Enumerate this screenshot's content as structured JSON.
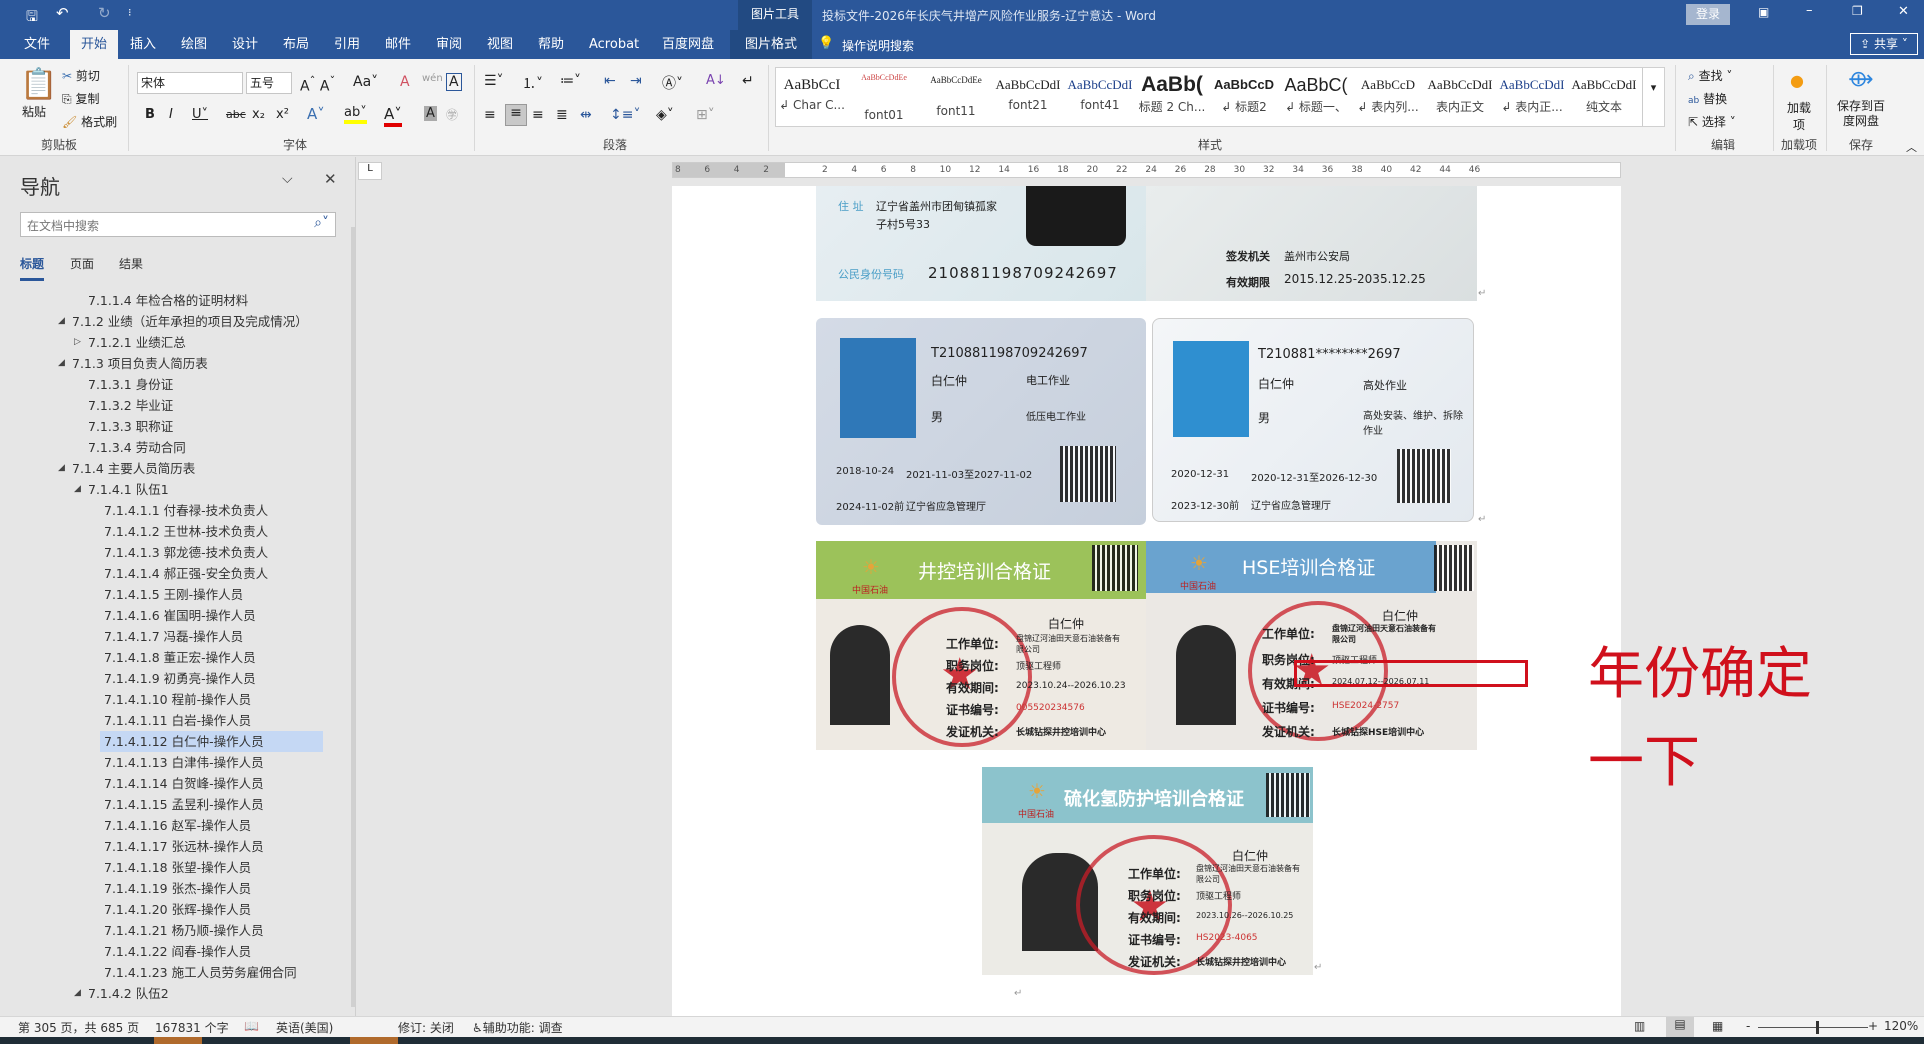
{
  "titlebar": {
    "context_tool": "图片工具",
    "title": "投标文件-2026年长庆气井增产风险作业服务-辽宁意达  -  Word",
    "login": "登录",
    "icons": [
      "save-icon",
      "undo-icon",
      "redo-icon",
      "customize-icon",
      "ribbon-display-icon",
      "minimize-icon",
      "restore-icon",
      "close-icon"
    ]
  },
  "tabs": [
    {
      "label": "文件"
    },
    {
      "label": "开始",
      "active": true
    },
    {
      "label": "插入"
    },
    {
      "label": "绘图"
    },
    {
      "label": "设计"
    },
    {
      "label": "布局"
    },
    {
      "label": "引用"
    },
    {
      "label": "邮件"
    },
    {
      "label": "审阅"
    },
    {
      "label": "视图"
    },
    {
      "label": "帮助"
    },
    {
      "label": "Acrobat"
    },
    {
      "label": "百度网盘"
    },
    {
      "label": "图片格式"
    }
  ],
  "tell_me": "操作说明搜索",
  "share": "共享",
  "ribbon": {
    "clipboard": {
      "paste": "粘贴",
      "cut": "剪切",
      "copy": "复制",
      "format_painter": "格式刷",
      "label": "剪贴板"
    },
    "font": {
      "name": "宋体",
      "size": "五号",
      "label": "字体",
      "highlight_color": "#ffff00",
      "font_color": "#e00000"
    },
    "paragraph": {
      "label": "段落"
    },
    "styles": {
      "label": "样式",
      "items": [
        {
          "preview": "AaBbCcI",
          "name": "↲ Char C..."
        },
        {
          "preview": "AaBbCcDdEe",
          "name": "font01"
        },
        {
          "preview": "AaBbCcDdEe",
          "name": "font11"
        },
        {
          "preview": "AaBbCcDdI",
          "name": "font21"
        },
        {
          "preview": "AaBbCcDdI",
          "name": "font41"
        },
        {
          "preview": "AaBb(",
          "name": "标题 2 Ch..."
        },
        {
          "preview": "AaBbCcD",
          "name": "↲ 标题2"
        },
        {
          "preview": "AaBbC(",
          "name": "↲ 标题一、"
        },
        {
          "preview": "AaBbCcD",
          "name": "↲ 表内列..."
        },
        {
          "preview": "AaBbCcDdI",
          "name": "表内正文"
        },
        {
          "preview": "AaBbCcDdI",
          "name": "↲ 表内正..."
        },
        {
          "preview": "AaBbCcDdI",
          "name": "纯文本"
        }
      ]
    },
    "editing": {
      "find": "查找",
      "replace": "替换",
      "select": "选择",
      "label": "编辑"
    },
    "addins": {
      "button": "加载项",
      "label": "加载项"
    },
    "save": {
      "button": "保存到百度网盘",
      "label": "保存"
    }
  },
  "nav": {
    "title": "导航",
    "search_placeholder": "在文档中搜索",
    "tabs": [
      "标题",
      "页面",
      "结果"
    ],
    "active_tab": "标题",
    "items": [
      {
        "text": "7.1.1.4 年检合格的证明材料",
        "level": 3,
        "toggle": "none"
      },
      {
        "text": "7.1.2 业绩（近年承担的项目及完成情况）",
        "level": 2,
        "toggle": "expanded"
      },
      {
        "text": "7.1.2.1 业绩汇总",
        "level": 3,
        "toggle": "collapsed"
      },
      {
        "text": "7.1.3 项目负责人简历表",
        "level": 2,
        "toggle": "expanded"
      },
      {
        "text": "7.1.3.1 身份证",
        "level": 3,
        "toggle": "none"
      },
      {
        "text": "7.1.3.2 毕业证",
        "level": 3,
        "toggle": "none"
      },
      {
        "text": "7.1.3.3 职称证",
        "level": 3,
        "toggle": "none"
      },
      {
        "text": "7.1.3.4 劳动合同",
        "level": 3,
        "toggle": "none"
      },
      {
        "text": "7.1.4 主要人员简历表",
        "level": 2,
        "toggle": "expanded"
      },
      {
        "text": "7.1.4.1 队伍1",
        "level": 3,
        "toggle": "expanded"
      },
      {
        "text": "7.1.4.1.1 付春禄-技术负责人",
        "level": 4,
        "toggle": "none"
      },
      {
        "text": "7.1.4.1.2 王世林-技术负责人",
        "level": 4,
        "toggle": "none"
      },
      {
        "text": "7.1.4.1.3 郭龙德-技术负责人",
        "level": 4,
        "toggle": "none"
      },
      {
        "text": "7.1.4.1.4 郝正强-安全负责人",
        "level": 4,
        "toggle": "none"
      },
      {
        "text": "7.1.4.1.5 王刚-操作人员",
        "level": 4,
        "toggle": "none"
      },
      {
        "text": "7.1.4.1.6 崔国明-操作人员",
        "level": 4,
        "toggle": "none"
      },
      {
        "text": "7.1.4.1.7 冯磊-操作人员",
        "level": 4,
        "toggle": "none"
      },
      {
        "text": "7.1.4.1.8 董正宏-操作人员",
        "level": 4,
        "toggle": "none"
      },
      {
        "text": "7.1.4.1.9 初勇亮-操作人员",
        "level": 4,
        "toggle": "none"
      },
      {
        "text": "7.1.4.1.10 程前-操作人员",
        "level": 4,
        "toggle": "none"
      },
      {
        "text": "7.1.4.1.11 白岩-操作人员",
        "level": 4,
        "toggle": "none"
      },
      {
        "text": "7.1.4.1.12 白仁仲-操作人员",
        "level": 4,
        "toggle": "none",
        "selected": true
      },
      {
        "text": "7.1.4.1.13 白津伟-操作人员",
        "level": 4,
        "toggle": "none"
      },
      {
        "text": "7.1.4.1.14 白贺峰-操作人员",
        "level": 4,
        "toggle": "none"
      },
      {
        "text": "7.1.4.1.15 孟昱利-操作人员",
        "level": 4,
        "toggle": "none"
      },
      {
        "text": "7.1.4.1.16 赵军-操作人员",
        "level": 4,
        "toggle": "none"
      },
      {
        "text": "7.1.4.1.17 张远林-操作人员",
        "level": 4,
        "toggle": "none"
      },
      {
        "text": "7.1.4.1.18 张望-操作人员",
        "level": 4,
        "toggle": "none"
      },
      {
        "text": "7.1.4.1.19 张杰-操作人员",
        "level": 4,
        "toggle": "none"
      },
      {
        "text": "7.1.4.1.20 张辉-操作人员",
        "level": 4,
        "toggle": "none"
      },
      {
        "text": "7.1.4.1.21 杨乃顺-操作人员",
        "level": 4,
        "toggle": "none"
      },
      {
        "text": "7.1.4.1.22 阎春-操作人员",
        "level": 4,
        "toggle": "none"
      },
      {
        "text": "7.1.4.1.23 施工人员劳务雇佣合同",
        "level": 4,
        "toggle": "none"
      },
      {
        "text": "7.1.4.2 队伍2",
        "level": 3,
        "toggle": "expanded"
      }
    ]
  },
  "ruler": {
    "labels": [
      "8",
      "6",
      "4",
      "2",
      "",
      "2",
      "4",
      "6",
      "8",
      "10",
      "12",
      "14",
      "16",
      "18",
      "20",
      "22",
      "24",
      "26",
      "28",
      "30",
      "32",
      "34",
      "36",
      "38",
      "40",
      "42",
      "44",
      "46"
    ]
  },
  "document": {
    "id_card": {
      "addr_label": "住 址",
      "addr": "辽宁省盖州市团甸镇孤家",
      "addr2": "子村5号33",
      "id_label": "公民身份号码",
      "id": "210881198709242697",
      "issuer_label": "签发机关",
      "issuer": "盖州市公安局",
      "valid_label": "有效期限",
      "valid": "2015.12.25-2035.12.25"
    },
    "op_cards": [
      {
        "no": "T210881198709242697",
        "name": "白仁仲",
        "type": "电工作业",
        "sex": "男",
        "item": "低压电工作业",
        "first": "2018-10-24",
        "valid": "2021-11-03至2027-11-02",
        "review": "2024-11-02前",
        "issuer": "辽宁省应急管理厅"
      },
      {
        "no": "T210881********2697",
        "name": "白仁仲",
        "type": "高处作业",
        "sex": "男",
        "item": "高处安装、维护、拆除作业",
        "first": "2020-12-31",
        "valid": "2020-12-31至2026-12-30",
        "review": "2023-12-30前",
        "issuer": "辽宁省应急管理厅"
      }
    ],
    "train_cards": [
      {
        "title": "井控培训合格证",
        "brand": "中国石油",
        "name": "白仁仲",
        "unit": "盘锦辽河油田天意石油装备有限公司",
        "post": "顶驱工程师",
        "valid": "2023.10.24--2026.10.23",
        "cert_no": "005520234576",
        "issuer": "长城钻探井控培训中心",
        "color": "#9cc25a"
      },
      {
        "title": "HSE培训合格证",
        "brand": "中国石油",
        "name": "白仁仲",
        "unit": "盘锦辽河油田天意石油装备有限公司",
        "post": "顶驱工程师",
        "valid": "2024.07.12--2026.07.11",
        "cert_no": "HSE2024-2757",
        "issuer": "长城钻探HSE培训中心",
        "color": "#6aa3cf"
      },
      {
        "title": "硫化氢防护培训合格证",
        "brand": "中国石油",
        "name": "白仁仲",
        "unit": "盘锦辽河油田天意石油装备有限公司",
        "post": "顶驱工程师",
        "valid": "2023.10.26--2026.10.25",
        "cert_no": "HS2023-4065",
        "issuer": "长城钻探井控培训中心",
        "color": "#8cc3cc"
      }
    ],
    "labels": {
      "unit": "工作单位:",
      "post": "职务岗位:",
      "valid": "有效期间:",
      "cert_no": "证书编号:",
      "issuer": "发证机关:"
    },
    "annotation": {
      "line1": "年份确定",
      "line2": "一下",
      "color": "#d0101c"
    }
  },
  "status": {
    "page": "第 305 页，共 685 页",
    "words": "167831 个字",
    "language": "英语(美国)",
    "track": "修订: 关闭",
    "accessibility": "辅助功能: 调查",
    "zoom": "120%",
    "zoom_level": 120
  }
}
